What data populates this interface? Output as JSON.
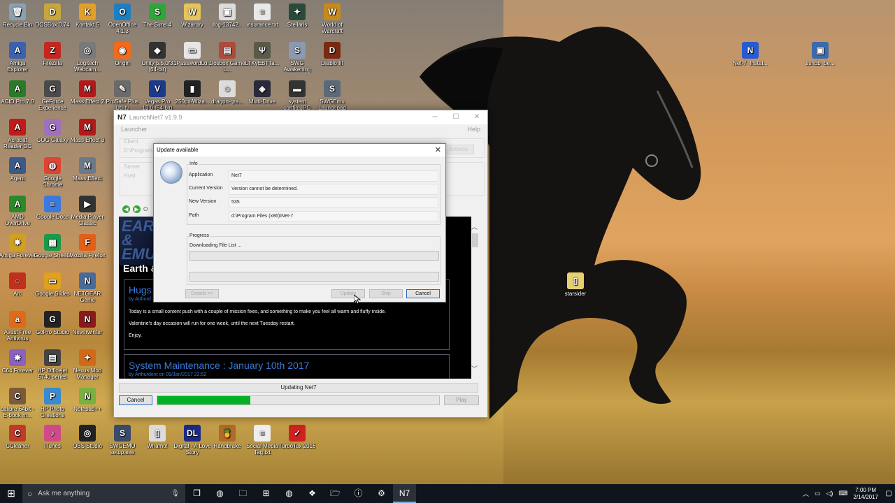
{
  "desktop": {
    "icons": [
      {
        "label": "Recycle Bin",
        "color": "#8aa1b3",
        "glyph": "🗑"
      },
      {
        "label": "DOSBox 0.74",
        "color": "#c7a73d",
        "glyph": "D"
      },
      {
        "label": "Kontakt 5",
        "color": "#e0a02a",
        "glyph": "K"
      },
      {
        "label": "OpenOffice 4.1.3",
        "color": "#1d7fc2",
        "glyph": "O"
      },
      {
        "label": "The Sims 4",
        "color": "#2fa63a",
        "glyph": "S"
      },
      {
        "label": "Wizardry",
        "color": "#e6c45a",
        "glyph": "W"
      },
      {
        "label": "dog-13742...",
        "color": "#dcdcdc",
        "glyph": "▣"
      },
      {
        "label": "insurance.txt",
        "color": "#e8e8e8",
        "glyph": "≡"
      },
      {
        "label": "Stellaris",
        "color": "#2a4a3a",
        "glyph": "✦"
      },
      {
        "label": "World of Warcraft",
        "color": "#c78a1a",
        "glyph": "W"
      },
      {
        "label": "Amiga Explorer",
        "color": "#3a62b0",
        "glyph": "A"
      },
      {
        "label": "FileZilla",
        "color": "#c3271e",
        "glyph": "Z"
      },
      {
        "label": "Logitech Webcam...",
        "color": "#7a7a7a",
        "glyph": "◎"
      },
      {
        "label": "Origin",
        "color": "#f26a1b",
        "glyph": "◉"
      },
      {
        "label": "Unity 5.5.0f3 (64-bit)",
        "color": "#333333",
        "glyph": "◆"
      },
      {
        "label": "1PasswordLo...",
        "color": "#e6e6e6",
        "glyph": "▭"
      },
      {
        "label": "Dosbox Game L...",
        "color": "#b04a3a",
        "glyph": "▤"
      },
      {
        "label": "LTKyEBTTa...",
        "color": "#5a5a4a",
        "glyph": "Ψ"
      },
      {
        "label": "SWG Awakening",
        "color": "#8a9ab0",
        "glyph": "S"
      },
      {
        "label": "Diablo III",
        "color": "#7a2a10",
        "glyph": "D"
      },
      {
        "label": "ACID Pro 7.0",
        "color": "#2a7a2a",
        "glyph": "A"
      },
      {
        "label": "GeForce Experience",
        "color": "#4a4a4a",
        "glyph": "G"
      },
      {
        "label": "Mass Effect 2",
        "color": "#b01a1a",
        "glyph": "M"
      },
      {
        "label": "ProSafe Plus Utility",
        "color": "#6a6a6a",
        "glyph": "✎"
      },
      {
        "label": "Vegas Pro 13.0 (64-bit)",
        "color": "#1a3a8a",
        "glyph": "V"
      },
      {
        "label": "250px-Wiza...",
        "color": "#222222",
        "glyph": "▮"
      },
      {
        "label": "dragon-gra...",
        "color": "#dcdcdc",
        "glyph": "☺"
      },
      {
        "label": "Multi-Drive",
        "color": "#2a2a3a",
        "glyph": "◈"
      },
      {
        "label": "system config.JPG",
        "color": "#333333",
        "glyph": "▬"
      },
      {
        "label": "SWGEmu Launchpad",
        "color": "#5a6a7a",
        "glyph": "S"
      },
      {
        "label": "Acrobat Reader DC",
        "color": "#c01a1a",
        "glyph": "A"
      },
      {
        "label": "GOG Galaxy",
        "color": "#a070c0",
        "glyph": "G"
      },
      {
        "label": "Mass Effect 3",
        "color": "#b01a1a",
        "glyph": "M"
      },
      {
        "label": "Agent",
        "color": "#3a5a8a",
        "glyph": "A"
      },
      {
        "label": "Google Chrome",
        "color": "#dd4433",
        "glyph": "◍"
      },
      {
        "label": "Mass Effect",
        "color": "#6a7a8a",
        "glyph": "M"
      },
      {
        "label": "AMD OverDrive",
        "color": "#2a8a2a",
        "glyph": "A"
      },
      {
        "label": "Google Docs",
        "color": "#3a7ae0",
        "glyph": "≡"
      },
      {
        "label": "Media Player Classic",
        "color": "#333333",
        "glyph": "▶"
      },
      {
        "label": "Amiga Forever",
        "color": "#d0a020",
        "glyph": "✸"
      },
      {
        "label": "Google Sheets",
        "color": "#1a9a4a",
        "glyph": "▦"
      },
      {
        "label": "Mozilla Firefox",
        "color": "#e0601a",
        "glyph": "F"
      },
      {
        "label": "Arc",
        "color": "#c0301a",
        "glyph": "◌"
      },
      {
        "label": "Google Slides",
        "color": "#e0a020",
        "glyph": "▭"
      },
      {
        "label": "NETGEAR Genie",
        "color": "#4a6a9a",
        "glyph": "N"
      },
      {
        "label": "Avast Free Antivirus",
        "color": "#e06a1a",
        "glyph": "a"
      },
      {
        "label": "GoPro Studio",
        "color": "#222222",
        "glyph": "G"
      },
      {
        "label": "Neverwinter",
        "color": "#8a1a1a",
        "glyph": "N"
      },
      {
        "label": "C64 Forever",
        "color": "#8a60c0",
        "glyph": "✸"
      },
      {
        "label": "HP Officejet 5740 series",
        "color": "#444444",
        "glyph": "▤"
      },
      {
        "label": "Nexus Mod Manager",
        "color": "#d06a1a",
        "glyph": "✦"
      },
      {
        "label": "calibre 64bit - E-book m...",
        "color": "#7a5a3a",
        "glyph": "C"
      },
      {
        "label": "HP Photo Creations",
        "color": "#3a8ad0",
        "glyph": "P"
      },
      {
        "label": "Notepad++",
        "color": "#7ab040",
        "glyph": "N"
      },
      {
        "label": "CCleaner",
        "color": "#c03a2a",
        "glyph": "C"
      },
      {
        "label": "iTunes",
        "color": "#d04a8a",
        "glyph": "♪"
      },
      {
        "label": "OBS Studio",
        "color": "#222222",
        "glyph": "◎"
      },
      {
        "label": "SWGEMU setup.exe",
        "color": "#3a4a6a",
        "glyph": "S"
      },
      {
        "label": "Whamo!",
        "color": "#dcdcdc",
        "glyph": "▯"
      },
      {
        "label": "Digital - A Love Story",
        "color": "#1a2a8a",
        "glyph": "DL"
      },
      {
        "label": "Handbrake",
        "color": "#b06a2a",
        "glyph": "🍍"
      },
      {
        "label": "Social Media Tag.txt",
        "color": "#eeeeee",
        "glyph": "≡"
      },
      {
        "label": "TurboTax 2016",
        "color": "#d02020",
        "glyph": "✓"
      },
      {
        "label": "Net-7_Instal...",
        "color": "#2a5ad0",
        "glyph": "N"
      },
      {
        "label": "ssndb_de...",
        "color": "#3a6ab0",
        "glyph": "▣"
      },
      {
        "label": "starsider",
        "color": "#e8d070",
        "glyph": "▯"
      }
    ]
  },
  "launcher": {
    "logo": "N7",
    "title": "LaunchNet7 v1.9.9",
    "menu_left": "Launcher",
    "menu_right": "Help",
    "client_caption": "Client",
    "client_path": "D:\\Program Fi",
    "browse_label": "Browse",
    "server_caption": "Server",
    "host_label": "Host",
    "nav_extra": "O",
    "news": {
      "banner_text": "EAR & EMU",
      "earth_heading": "Earth &",
      "post1_title": "Hugs",
      "post1_author": "by Arthurd",
      "post1_para1": "Today is a small content push with a couple of mission fixes, and something to make you feel all warm and fluffy inside.",
      "post1_para2": "Valentine's day occasion will run for one week, until the next Tuesday restart.",
      "post1_para3": "Enjoy.",
      "post2_title": "System Maintenance : January 10th 2017",
      "post2_author": "by Arthurdent on 09/Jan/2017 22:52"
    },
    "status_text": "Updating Net7",
    "cancel_label": "Cancel",
    "play_label": "Play",
    "progress": 0.33
  },
  "dialog": {
    "title": "Update available",
    "info_caption": "Info",
    "rows": [
      {
        "key": "Application",
        "value": "Net7"
      },
      {
        "key": "Current Version",
        "value": "Version cannot be determined."
      },
      {
        "key": "New Version",
        "value": "535"
      },
      {
        "key": "Path",
        "value": "d:\\Program Files (x86)\\Net-7"
      }
    ],
    "progress_caption": "Progress",
    "progress_status": "Downloading File List ...",
    "details_label": "Details >>",
    "update_label": "Update",
    "skip_label": "Skip",
    "cancel_label": "Cancel"
  },
  "taskbar": {
    "search_placeholder": "Ask me anything",
    "apps": [
      "❐",
      "◍",
      "🗀",
      "⊞",
      "◍",
      "❖",
      "🗁",
      "ⓘ",
      "⚙",
      "N7"
    ],
    "time": "7:00 PM",
    "date": "2/14/2017"
  }
}
